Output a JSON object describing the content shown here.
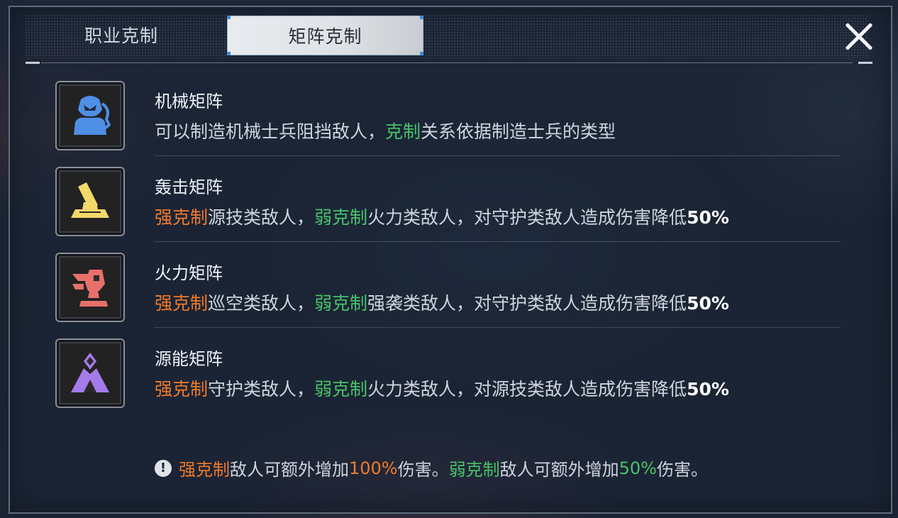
{
  "tabs": {
    "inactive_label": "职业克制",
    "active_label": "矩阵克制"
  },
  "close_icon": "close-icon",
  "matrices": [
    {
      "title": "机械矩阵",
      "icon": "mech-soldier-icon",
      "icon_color": "#4f8fe6",
      "desc": {
        "p1": "可以制造机械士兵阻挡敌人，",
        "g1": "克制",
        "p2": "关系依据制造士兵的类型"
      }
    },
    {
      "title": "轰击矩阵",
      "icon": "cannon-icon",
      "icon_color": "#f3d86a",
      "desc": {
        "o1": "强克制",
        "p1": "源技类敌人，",
        "g1": "弱克制",
        "p2": "火力类敌人，对守护类敌人造成伤害降低",
        "pct": "50%"
      }
    },
    {
      "title": "火力矩阵",
      "icon": "turret-icon",
      "icon_color": "#e8706b",
      "desc": {
        "o1": "强克制",
        "p1": "巡空类敌人，",
        "g1": "弱克制",
        "p2": "强袭类敌人，对守护类敌人造成伤害降低",
        "pct": "50%"
      }
    },
    {
      "title": "源能矩阵",
      "icon": "energy-tent-icon",
      "icon_color": "#a57bea",
      "desc": {
        "o1": "强克制",
        "p1": "守护类敌人，",
        "g1": "弱克制",
        "p2": "火力类敌人，对源技类敌人造成伤害降低",
        "pct": "50%"
      }
    }
  ],
  "note": {
    "icon": "warning-icon",
    "o1": "强克制",
    "p1": "敌人可额外增加",
    "o2": "100%",
    "p2": "伤害。",
    "g1": "弱克制",
    "p3": "敌人可额外增加",
    "g2": "50%",
    "p4": "伤害。"
  },
  "colors": {
    "strong": "#f07a2a",
    "weak": "#49c268",
    "accent": "#3e8ed8"
  }
}
